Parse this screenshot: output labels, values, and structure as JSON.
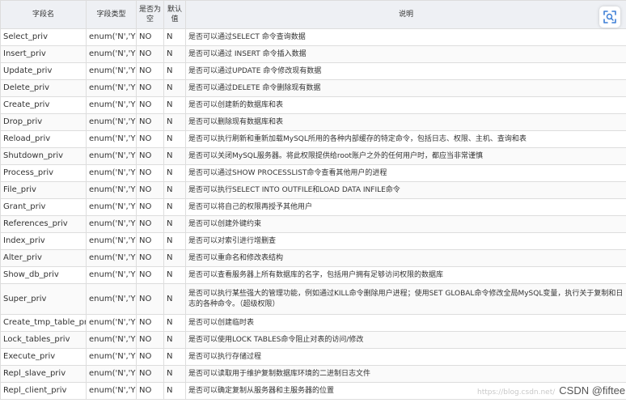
{
  "table": {
    "headers": {
      "field_name": "字段名",
      "field_type": "字段类型",
      "nullable": "是否为空",
      "default": "默认值",
      "description": "说明"
    },
    "rows": [
      {
        "name": "Select_priv",
        "type": "enum('N','Y')",
        "nullable": "NO",
        "default": "N",
        "desc": "是否可以通过SELECT 命令查询数据"
      },
      {
        "name": "Insert_priv",
        "type": "enum('N','Y')",
        "nullable": "NO",
        "default": "N",
        "desc": "是否可以通过 INSERT 命令插入数据"
      },
      {
        "name": "Update_priv",
        "type": "enum('N','Y')",
        "nullable": "NO",
        "default": "N",
        "desc": "是否可以通过UPDATE 命令修改现有数据"
      },
      {
        "name": "Delete_priv",
        "type": "enum('N','Y')",
        "nullable": "NO",
        "default": "N",
        "desc": "是否可以通过DELETE 命令删除现有数据"
      },
      {
        "name": "Create_priv",
        "type": "enum('N','Y')",
        "nullable": "NO",
        "default": "N",
        "desc": "是否可以创建新的数据库和表"
      },
      {
        "name": "Drop_priv",
        "type": "enum('N','Y')",
        "nullable": "NO",
        "default": "N",
        "desc": "是否可以删除现有数据库和表"
      },
      {
        "name": "Reload_priv",
        "type": "enum('N','Y')",
        "nullable": "NO",
        "default": "N",
        "desc": "是否可以执行刷新和重新加载MySQL所用的各种内部缓存的特定命令，包括日志、权限、主机、查询和表"
      },
      {
        "name": "Shutdown_priv",
        "type": "enum('N','Y')",
        "nullable": "NO",
        "default": "N",
        "desc": "是否可以关闭MySQL服务器。将此权限提供给root账户之外的任何用户时，都应当非常谨慎"
      },
      {
        "name": "Process_priv",
        "type": "enum('N','Y')",
        "nullable": "NO",
        "default": "N",
        "desc": "是否可以通过SHOW PROCESSLIST命令查看其他用户的进程"
      },
      {
        "name": "File_priv",
        "type": "enum('N','Y')",
        "nullable": "NO",
        "default": "N",
        "desc": "是否可以执行SELECT INTO OUTFILE和LOAD DATA INFILE命令"
      },
      {
        "name": "Grant_priv",
        "type": "enum('N','Y')",
        "nullable": "NO",
        "default": "N",
        "desc": "是否可以将自己的权限再授予其他用户"
      },
      {
        "name": "References_priv",
        "type": "enum('N','Y')",
        "nullable": "NO",
        "default": "N",
        "desc": "是否可以创建外键约束"
      },
      {
        "name": "Index_priv",
        "type": "enum('N','Y')",
        "nullable": "NO",
        "default": "N",
        "desc": "是否可以对索引进行增删查"
      },
      {
        "name": "Alter_priv",
        "type": "enum('N','Y')",
        "nullable": "NO",
        "default": "N",
        "desc": "是否可以重命名和修改表结构"
      },
      {
        "name": "Show_db_priv",
        "type": "enum('N','Y')",
        "nullable": "NO",
        "default": "N",
        "desc": "是否可以查看服务器上所有数据库的名字，包括用户拥有足够访问权限的数据库"
      },
      {
        "name": "Super_priv",
        "type": "enum('N','Y')",
        "nullable": "NO",
        "default": "N",
        "desc": "是否可以执行某些强大的管理功能，例如通过KILL命令删除用户进程；使用SET GLOBAL命令修改全局MySQL变量，执行关于复制和日志的各种命令。（超级权限）"
      },
      {
        "name": "Create_tmp_table_priv",
        "type": "enum('N','Y')",
        "nullable": "NO",
        "default": "N",
        "desc": "是否可以创建临时表"
      },
      {
        "name": "Lock_tables_priv",
        "type": "enum('N','Y')",
        "nullable": "NO",
        "default": "N",
        "desc": "是否可以使用LOCK TABLES命令阻止对表的访问/修改"
      },
      {
        "name": "Execute_priv",
        "type": "enum('N','Y')",
        "nullable": "NO",
        "default": "N",
        "desc": "是否可以执行存储过程"
      },
      {
        "name": "Repl_slave_priv",
        "type": "enum('N','Y')",
        "nullable": "NO",
        "default": "N",
        "desc": "是否可以读取用于维护复制数据库环境的二进制日志文件"
      },
      {
        "name": "Repl_client_priv",
        "type": "enum('N','Y')",
        "nullable": "NO",
        "default": "N",
        "desc": "是否可以确定复制从服务器和主服务器的位置"
      }
    ]
  },
  "scan_button": {
    "icon": "scan-icon"
  },
  "watermark": {
    "faint_text": "https://blog.csdn.net/",
    "text": "CSDN @fifteenzz"
  },
  "colors": {
    "header_bg": "#eef0f4",
    "border": "#dddddd",
    "text": "#333333",
    "icon_blue": "#3d7fd6"
  }
}
